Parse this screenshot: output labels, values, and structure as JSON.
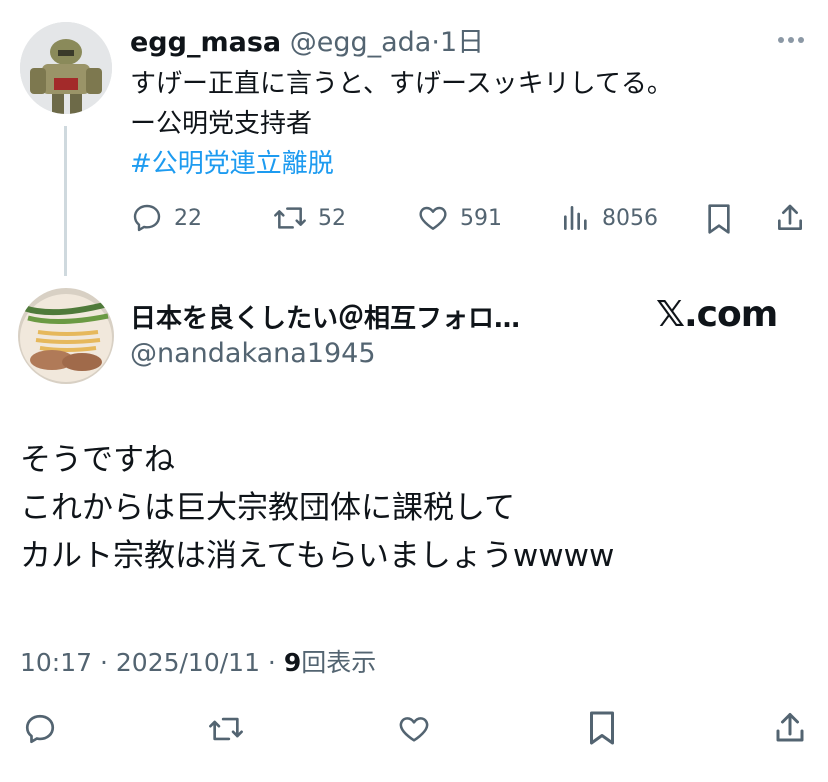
{
  "parent_tweet": {
    "author_name": "egg_masa",
    "handle": "@egg_ada",
    "separator": "·",
    "time": "1日",
    "text_lines": [
      "すげー正直に言うと、すげースッキリしてる。",
      "ー公明党支持者"
    ],
    "hashtag": "#公明党連立離脱",
    "stats": {
      "replies": "22",
      "retweets": "52",
      "likes": "591",
      "views": "8056"
    },
    "more_icon": "more-dots-icon"
  },
  "main_tweet": {
    "author_name": "日本を良くしたい＠相互フォロ…",
    "handle": "@nandakana1945",
    "brand": "𝕏.com",
    "text_lines": [
      "そうですね",
      "これからは巨大宗教団体に課税して",
      "カルト宗教は消えてもらいましょうwwww"
    ],
    "meta": {
      "time": "10:17",
      "sep1": " · ",
      "date": "2025/10/11",
      "sep2": " · ",
      "views_count": "9",
      "views_label": "回表示"
    }
  },
  "colors": {
    "text": "#0f1419",
    "secondary": "#536471",
    "link": "#1d9bf0",
    "thread_line": "#cfd9de"
  }
}
